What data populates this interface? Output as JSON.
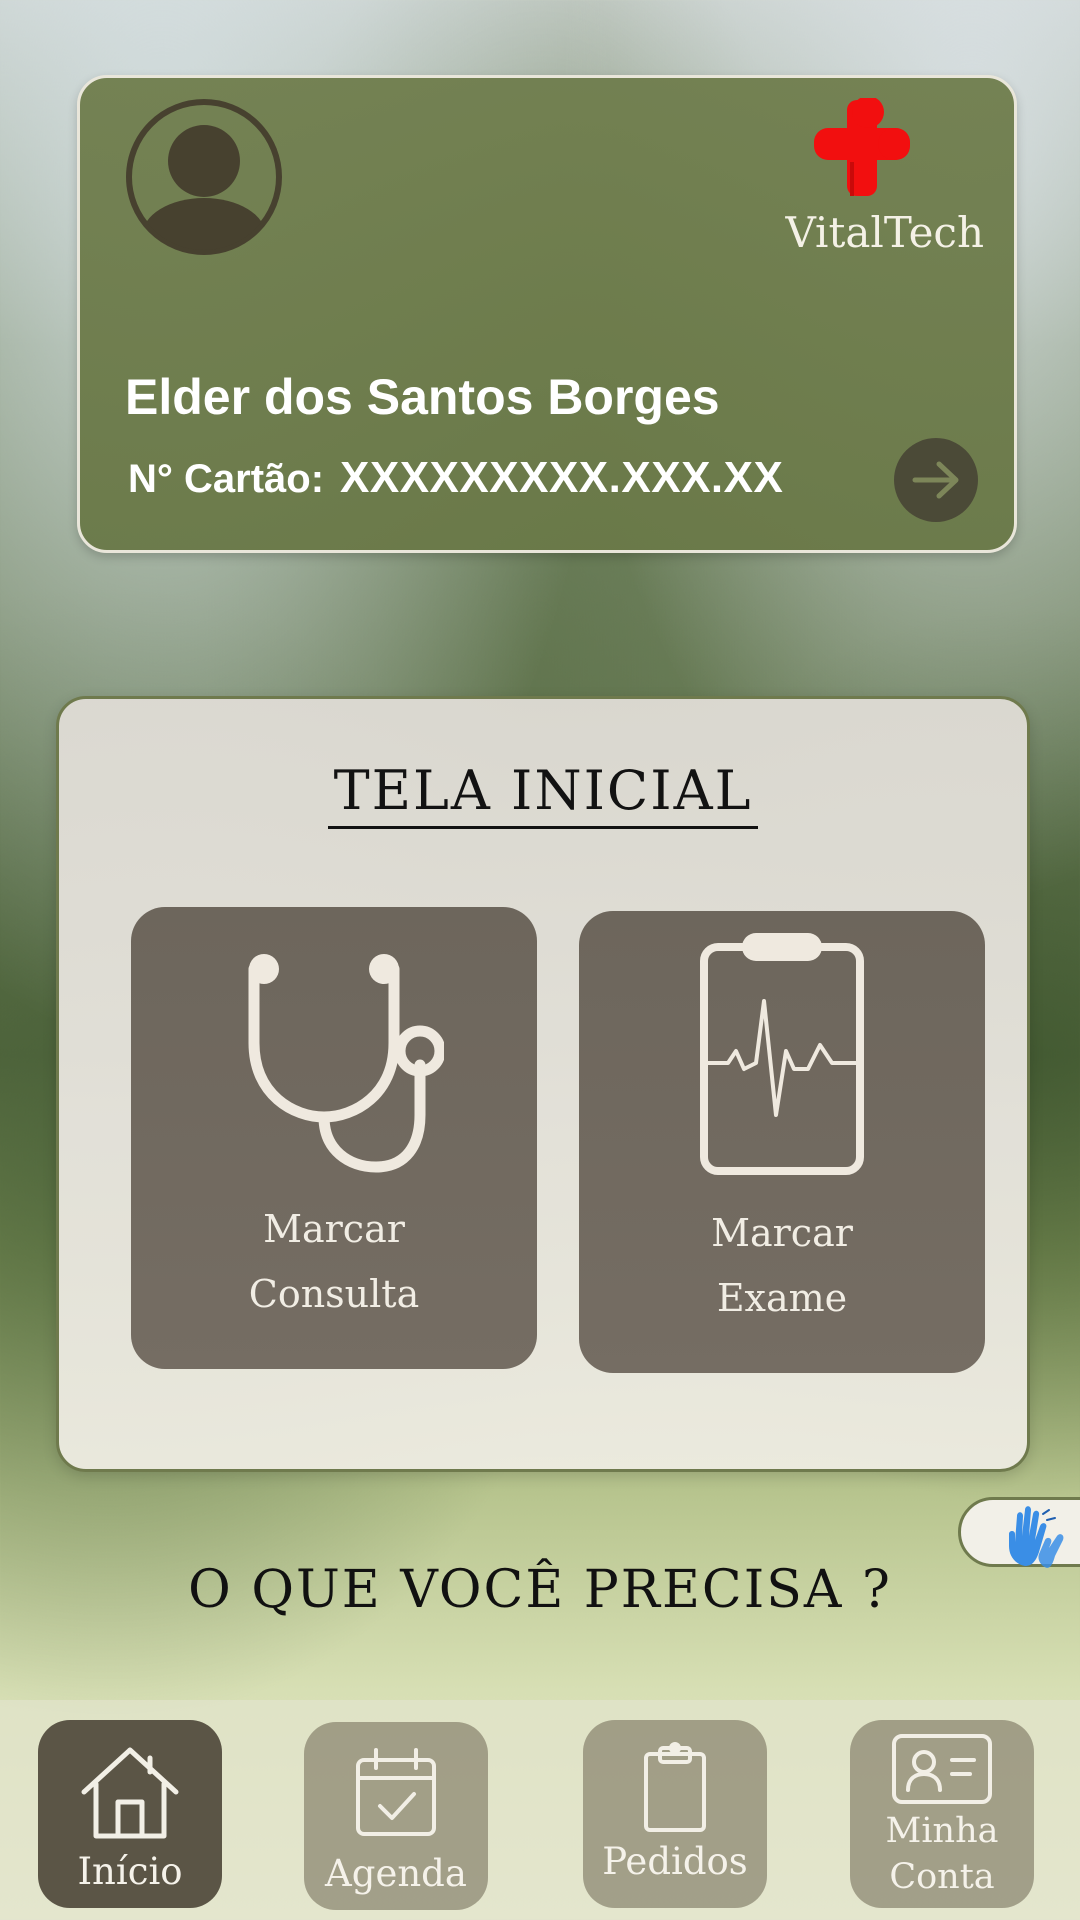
{
  "member_card": {
    "brand_name": "VitalTech",
    "member_name": "Elder dos Santos Borges",
    "card_number_label": "N° Cartão:",
    "card_number_value": "XXXXXXXXX.XXX.XX",
    "icons": {
      "avatar": "user-avatar-icon",
      "logo": "red-cross-logo",
      "arrow": "arrow-right-icon"
    }
  },
  "home_panel": {
    "title": "TELA INICIAL",
    "actions": [
      {
        "line1": "Marcar",
        "line2": "Consulta",
        "icon": "stethoscope-icon"
      },
      {
        "line1": "Marcar",
        "line2": "Exame",
        "icon": "clipboard-heartbeat-icon"
      }
    ]
  },
  "accessibility": {
    "icon": "sign-language-hands-icon"
  },
  "question": "O QUE VOCÊ PRECISA ?",
  "bottom_nav": {
    "items": [
      {
        "label": "Início",
        "icon": "home-icon",
        "active": true
      },
      {
        "label": "Agenda",
        "icon": "calendar-check-icon",
        "active": false
      },
      {
        "label": "Pedidos",
        "icon": "clipboard-icon",
        "active": false
      },
      {
        "label_line1": "Minha",
        "label_line2": "Conta",
        "icon": "id-card-icon",
        "active": false
      }
    ]
  },
  "colors": {
    "card_green": "#6f7d4c",
    "panel_beige": "#e3e0d9",
    "action_brown": "#716a60",
    "nav_active": "#5b5546",
    "logo_red": "#f20f0f",
    "access_blue": "#3a8ee6"
  }
}
